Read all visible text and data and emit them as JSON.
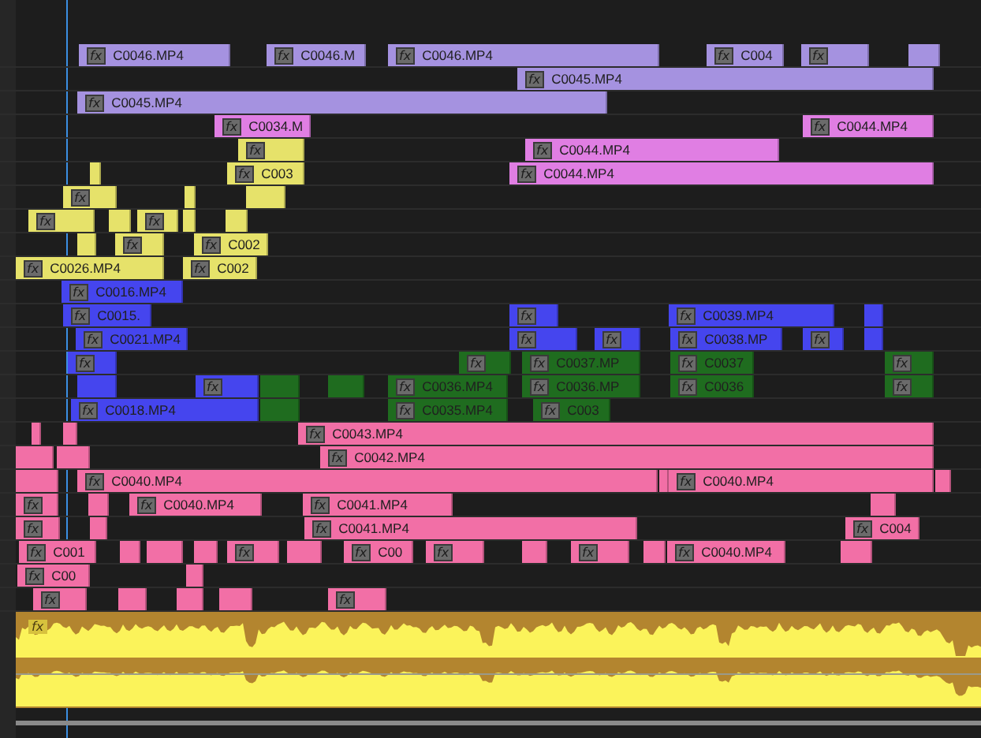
{
  "tracks": [
    {
      "clips": [
        {
          "label": "C0046.MP4",
          "badge": "fx",
          "color": "#a592e0"
        },
        {
          "label": "C0046.M",
          "badge": "fx",
          "color": "#a592e0"
        },
        {
          "label": "C0046.MP4",
          "badge": "fx",
          "color": "#a592e0"
        },
        {
          "label": "C004",
          "badge": "fx",
          "color": "#a592e0"
        },
        {
          "badge": "fx",
          "color": "#a592e0"
        },
        {
          "color": "#a592e0"
        }
      ]
    },
    {
      "clips": [
        {
          "label": "C0045.MP4",
          "badge": "fx",
          "color": "#a592e0"
        }
      ]
    },
    {
      "clips": [
        {
          "label": "C0045.MP4",
          "badge": "fx",
          "color": "#a592e0"
        }
      ]
    },
    {
      "clips": [
        {
          "label": "C0034.M",
          "badge": "fx",
          "color": "#e07ee3"
        },
        {
          "label": "C0044.MP4",
          "badge": "fx",
          "color": "#e07ee3"
        }
      ]
    },
    {
      "clips": [
        {
          "badge": "fx",
          "color": "#e6e26a"
        },
        {
          "label": "C0044.MP4",
          "badge": "fx",
          "color": "#e07ee3"
        }
      ]
    },
    {
      "clips": [
        {
          "color": "#e6e26a"
        },
        {
          "label": "C003",
          "badge": "fx",
          "color": "#e6e26a"
        },
        {
          "label": "C0044.MP4",
          "badge": "fx",
          "color": "#e07ee3"
        }
      ]
    },
    {
      "clips": [
        {
          "badge": "fx",
          "color": "#e6e26a"
        },
        {
          "color": "#e6e26a"
        },
        {
          "color": "#e6e26a"
        }
      ]
    },
    {
      "clips": [
        {
          "badge": "fx",
          "color": "#e6e26a"
        },
        {
          "color": "#e6e26a"
        },
        {
          "badge": "fx",
          "color": "#e6e26a"
        },
        {
          "color": "#e6e26a"
        },
        {
          "color": "#e6e26a"
        }
      ]
    },
    {
      "clips": [
        {
          "color": "#e6e26a"
        },
        {
          "badge": "fx",
          "color": "#e6e26a"
        },
        {
          "label": "C002",
          "badge": "fx",
          "color": "#e6e26a"
        }
      ]
    },
    {
      "clips": [
        {
          "label": "C0026.MP4",
          "badge": "fx",
          "color": "#e6e26a"
        },
        {
          "label": "C002",
          "badge": "fx",
          "color": "#e6e26a"
        }
      ]
    },
    {
      "clips": [
        {
          "label": "C0016.MP4",
          "badge": "fx",
          "color": "#4545ee"
        }
      ]
    },
    {
      "clips": [
        {
          "label": "C0015.",
          "badge": "fx",
          "color": "#4545ee"
        },
        {
          "badge": "fx",
          "color": "#4545ee"
        },
        {
          "label": "C0039.MP4",
          "badge": "fx",
          "color": "#4545ee"
        },
        {
          "color": "#4545ee"
        }
      ]
    },
    {
      "clips": [
        {
          "label": "C0021.MP4",
          "badge": "fx",
          "color": "#4545ee"
        },
        {
          "badge": "fx",
          "color": "#4545ee"
        },
        {
          "badge": "fx",
          "color": "#4545ee"
        },
        {
          "label": "C0038.MP",
          "badge": "fx",
          "color": "#4545ee"
        },
        {
          "badge": "fx",
          "color": "#4545ee"
        },
        {
          "color": "#4545ee"
        }
      ]
    },
    {
      "clips": [
        {
          "badge": "fx",
          "color": "#4545ee"
        },
        {
          "badge": "fx",
          "color": "#1f6c1f"
        },
        {
          "label": "C0037.MP",
          "badge": "fx",
          "color": "#1f6c1f"
        },
        {
          "label": "C0037",
          "badge": "fx",
          "color": "#1f6c1f"
        },
        {
          "badge": "fx",
          "color": "#1f6c1f"
        }
      ]
    },
    {
      "clips": [
        {
          "color": "#4545ee"
        },
        {
          "badge": "fx",
          "color": "#4545ee"
        },
        {
          "color": "#1f6c1f"
        },
        {
          "color": "#1f6c1f"
        },
        {
          "label": "C0036.MP4",
          "badge": "fx",
          "color": "#1f6c1f"
        },
        {
          "label": "C0036.MP",
          "badge": "fx",
          "color": "#1f6c1f"
        },
        {
          "label": "C0036",
          "badge": "fx",
          "color": "#1f6c1f"
        },
        {
          "badge": "fx",
          "color": "#1f6c1f"
        }
      ]
    },
    {
      "clips": [
        {
          "label": "C0018.MP4",
          "badge": "fx",
          "color": "#4545ee"
        },
        {
          "color": "#1f6c1f"
        },
        {
          "label": "C0035.MP4",
          "badge": "fx",
          "color": "#1f6c1f"
        },
        {
          "label": "C003",
          "badge": "fx",
          "color": "#1f6c1f"
        }
      ]
    },
    {
      "clips": [
        {
          "color": "#f26fa6"
        },
        {
          "color": "#f26fa6"
        },
        {
          "label": "C0043.MP4",
          "badge": "fx",
          "color": "#f26fa6"
        }
      ]
    },
    {
      "clips": [
        {
          "color": "#f26fa6"
        },
        {
          "color": "#f26fa6"
        },
        {
          "label": "C0042.MP4",
          "badge": "fx",
          "color": "#f26fa6"
        }
      ]
    },
    {
      "clips": [
        {
          "color": "#f26fa6"
        },
        {
          "label": "C0040.MP4",
          "badge": "fx",
          "color": "#f26fa6"
        },
        {
          "color": "#f26fa6"
        },
        {
          "label": "C0040.MP4",
          "badge": "fx",
          "color": "#f26fa6"
        },
        {
          "color": "#f26fa6"
        }
      ]
    },
    {
      "clips": [
        {
          "badge": "fx",
          "color": "#f26fa6"
        },
        {
          "color": "#f26fa6"
        },
        {
          "label": "C0040.MP4",
          "badge": "fx",
          "color": "#f26fa6"
        },
        {
          "label": "C0041.MP4",
          "badge": "fx",
          "color": "#f26fa6"
        },
        {
          "color": "#f26fa6"
        }
      ]
    },
    {
      "clips": [
        {
          "badge": "fx",
          "color": "#f26fa6"
        },
        {
          "color": "#f26fa6"
        },
        {
          "label": "C0041.MP4",
          "badge": "fx",
          "color": "#f26fa6"
        },
        {
          "label": "C004",
          "badge": "fx",
          "color": "#f26fa6"
        }
      ]
    },
    {
      "clips": [
        {
          "label": "C001",
          "badge": "fx",
          "color": "#f26fa6"
        },
        {
          "color": "#f26fa6"
        },
        {
          "color": "#f26fa6"
        },
        {
          "color": "#f26fa6"
        },
        {
          "badge": "fx",
          "color": "#f26fa6"
        },
        {
          "color": "#f26fa6"
        },
        {
          "label": "C00",
          "badge": "fx",
          "color": "#f26fa6"
        },
        {
          "badge": "fx",
          "color": "#f26fa6"
        },
        {
          "color": "#f26fa6"
        },
        {
          "badge": "fx",
          "color": "#f26fa6"
        },
        {
          "color": "#f26fa6"
        },
        {
          "label": "C0040.MP4",
          "badge": "fx",
          "color": "#f26fa6"
        },
        {
          "color": "#f26fa6"
        }
      ]
    },
    {
      "clips": [
        {
          "label": "C00",
          "badge": "fx",
          "color": "#f26fa6"
        },
        {
          "color": "#f26fa6"
        }
      ]
    },
    {
      "clips": [
        {
          "badge": "fx",
          "color": "#f26fa6"
        },
        {
          "color": "#f26fa6"
        },
        {
          "color": "#f26fa6"
        },
        {
          "color": "#f26fa6"
        },
        {
          "badge": "fx",
          "color": "#f26fa6"
        }
      ]
    }
  ],
  "audio_track": {
    "badge": "fx"
  }
}
